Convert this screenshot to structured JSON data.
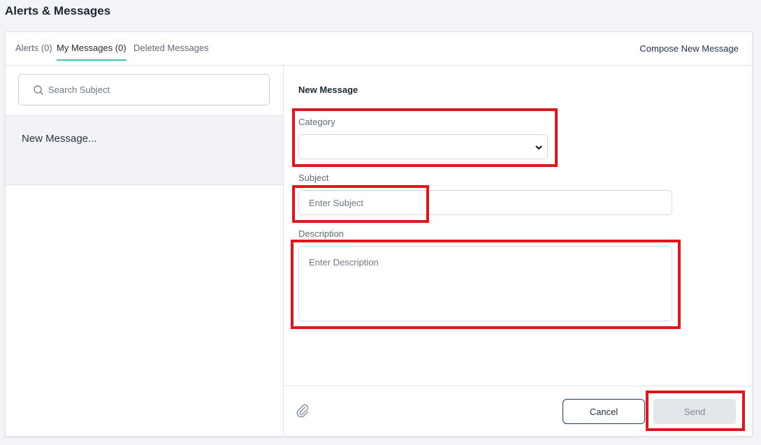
{
  "page": {
    "title": "Alerts & Messages"
  },
  "tabs": [
    {
      "label": "Alerts (0)",
      "active": false
    },
    {
      "label": "My Messages (0)",
      "active": true
    },
    {
      "label": "Deleted Messages",
      "active": false
    }
  ],
  "compose_label": "Compose New Message",
  "search": {
    "placeholder": "Search Subject",
    "icon": "search-icon"
  },
  "message_list": [
    {
      "label": "New Message..."
    }
  ],
  "form": {
    "title": "New Message",
    "category_label": "Category",
    "category_value": "",
    "subject_label": "Subject",
    "subject_placeholder": "Enter Subject",
    "description_label": "Description",
    "description_placeholder": "Enter Description"
  },
  "footer": {
    "attach_icon": "paperclip-icon",
    "cancel_label": "Cancel",
    "send_label": "Send"
  },
  "colors": {
    "accent": "#3cc9a1",
    "annotation": "#e3151c",
    "send_disabled_bg": "#e3e7ec",
    "cancel_border": "#1f3a5c"
  }
}
